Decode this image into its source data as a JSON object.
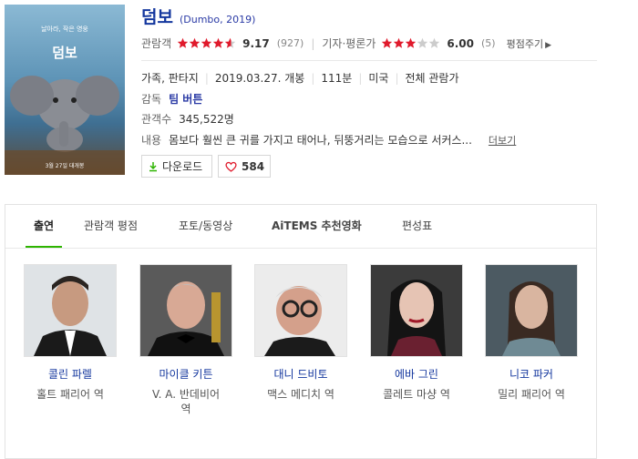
{
  "movie": {
    "title": "덤보",
    "original": "(Dumbo, 2019)",
    "poster_title": "덤보",
    "poster_tagline": "날아라, 작은 영웅",
    "poster_date": "3월 27일 대개봉"
  },
  "ratings": {
    "audience_label": "관람객",
    "audience_score": "9.17",
    "audience_count": "(927)",
    "audience_stars": 4.6,
    "critic_label": "기자·평론가",
    "critic_score": "6.00",
    "critic_count": "(5)",
    "critic_stars": 3.0,
    "give_label": "평점주기"
  },
  "info": {
    "genre": "가족, 판타지",
    "release": "2019.03.27. 개봉",
    "runtime": "111분",
    "country": "미국",
    "grade": "전체 관람가",
    "director_label": "감독",
    "director": "팀 버튼",
    "audience_total_label": "관객수",
    "audience_total": "345,522명",
    "summary_label": "내용",
    "summary": "몸보다 훨씬 큰 귀를 가지고 태어나, 뒤뚱거리는 모습으로 서커스...",
    "more_label": "더보기"
  },
  "buttons": {
    "download": "다운로드",
    "like_count": "584"
  },
  "tabs": [
    "출연",
    "관람객 평점",
    "포토/동영상",
    "AiTEMS 추천영화",
    "편성표"
  ],
  "cast": [
    {
      "name": "콜린 파렐",
      "role": "홀트 패리어 역",
      "role2": ""
    },
    {
      "name": "마이클 키튼",
      "role": "V. A. 반데비어",
      "role2": "역"
    },
    {
      "name": "대니 드비토",
      "role": "맥스 메디치 역",
      "role2": ""
    },
    {
      "name": "에바 그린",
      "role": "콜레트 마샹 역",
      "role2": ""
    },
    {
      "name": "니코 파커",
      "role": "밀리 패리어 역",
      "role2": ""
    }
  ],
  "colors": {
    "star": "#e01a2c",
    "star_empty": "#cccccc",
    "tab_active": "#2db400",
    "link": "#14379e"
  }
}
